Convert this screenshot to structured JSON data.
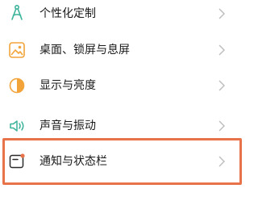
{
  "settings": {
    "items": [
      {
        "label": "个性化定制",
        "icon": "personalization-icon"
      },
      {
        "label": "桌面、锁屏与息屏",
        "icon": "wallpaper-icon"
      },
      {
        "label": "显示与亮度",
        "icon": "display-brightness-icon"
      },
      {
        "label": "声音与振动",
        "icon": "sound-vibration-icon"
      },
      {
        "label": "通知与状态栏",
        "icon": "notification-statusbar-icon"
      }
    ],
    "highlighted_item": "通知与状态栏"
  },
  "colors": {
    "icon_teal": "#3bb39a",
    "icon_orange": "#f2a43a",
    "highlight_border": "#e8734a",
    "text": "#1a1a1a",
    "chevron": "#bcbcbc"
  }
}
